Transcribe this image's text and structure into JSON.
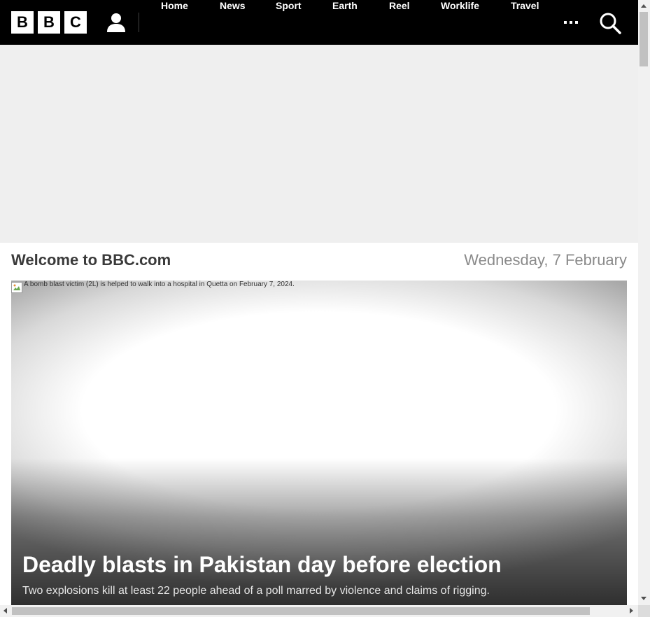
{
  "header": {
    "logo_letters": [
      "B",
      "B",
      "C"
    ],
    "nav": [
      {
        "label": "Home"
      },
      {
        "label": "News"
      },
      {
        "label": "Sport"
      },
      {
        "label": "Earth"
      },
      {
        "label": "Reel"
      },
      {
        "label": "Worklife"
      },
      {
        "label": "Travel"
      }
    ],
    "icons": {
      "account": "user-icon",
      "more": "more-dots-icon",
      "search": "search-icon"
    }
  },
  "welcome": {
    "title": "Welcome to BBC.com",
    "date": "Wednesday, 7 February"
  },
  "hero": {
    "image_alt": "A bomb blast victim (2L) is helped to walk into a hospital in Quetta on February 7, 2024.",
    "title": "Deadly blasts in Pakistan day before election",
    "summary": "Two explosions kill at least 22 people ahead of a poll marred by violence and claims of rigging."
  },
  "colors": {
    "header_bg": "#000000",
    "ad_bg": "#efefef",
    "welcome_text": "#3a3a3a",
    "date_text": "#8a8a8a"
  }
}
